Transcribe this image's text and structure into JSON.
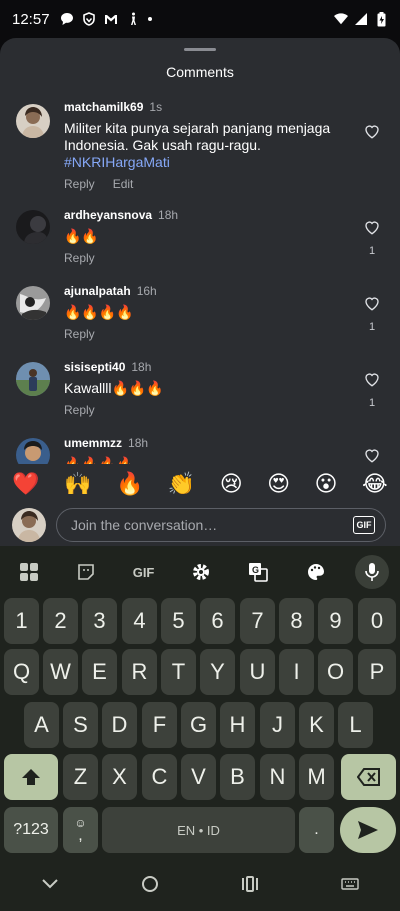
{
  "status_bar": {
    "time": "12:57"
  },
  "sheet": {
    "title": "Comments"
  },
  "comments": [
    {
      "username": "matchamilk69",
      "time": "1s",
      "text": "Militer kita punya sejarah panjang menjaga Indonesia. Gak usah ragu-ragu.",
      "hashtag": "#NKRIHargaMati",
      "reply_label": "Reply",
      "edit_label": "Edit",
      "likes": ""
    },
    {
      "username": "ardheyansnova",
      "time": "18h",
      "text": "🔥🔥",
      "reply_label": "Reply",
      "likes": "1"
    },
    {
      "username": "ajunalpatah",
      "time": "16h",
      "text": "🔥🔥🔥🔥",
      "reply_label": "Reply",
      "likes": "1"
    },
    {
      "username": "sisisepti40",
      "time": "18h",
      "text": "Kawallll🔥🔥🔥",
      "reply_label": "Reply",
      "likes": "1"
    },
    {
      "username": "umemmzz",
      "time": "18h",
      "text": "🔥🔥🔥🔥",
      "reply_label": "",
      "likes": ""
    }
  ],
  "emoji_reactions": [
    "❤️",
    "🙌",
    "🔥",
    "👏",
    "😢",
    "😍",
    "😮",
    "😂"
  ],
  "composer": {
    "placeholder": "Join the conversation…",
    "gif_label": "GIF"
  },
  "keyboard": {
    "toolbar_gif": "GIF",
    "row1": [
      "1",
      "2",
      "3",
      "4",
      "5",
      "6",
      "7",
      "8",
      "9",
      "0"
    ],
    "row2": [
      "Q",
      "W",
      "E",
      "R",
      "T",
      "Y",
      "U",
      "I",
      "O",
      "P"
    ],
    "row3": [
      "A",
      "S",
      "D",
      "F",
      "G",
      "H",
      "J",
      "K",
      "L"
    ],
    "row4": [
      "Z",
      "X",
      "C",
      "V",
      "B",
      "N",
      "M"
    ],
    "symbols_label": "?123",
    "emoji_comma_label": ",",
    "space_label": "EN • ID",
    "period_label": "."
  },
  "colors": {
    "sheet_bg": "#2b2d31",
    "hashtag": "#86a8f7",
    "keyboard_bg": "#1f231e",
    "accent_key": "#b7c6a4"
  }
}
